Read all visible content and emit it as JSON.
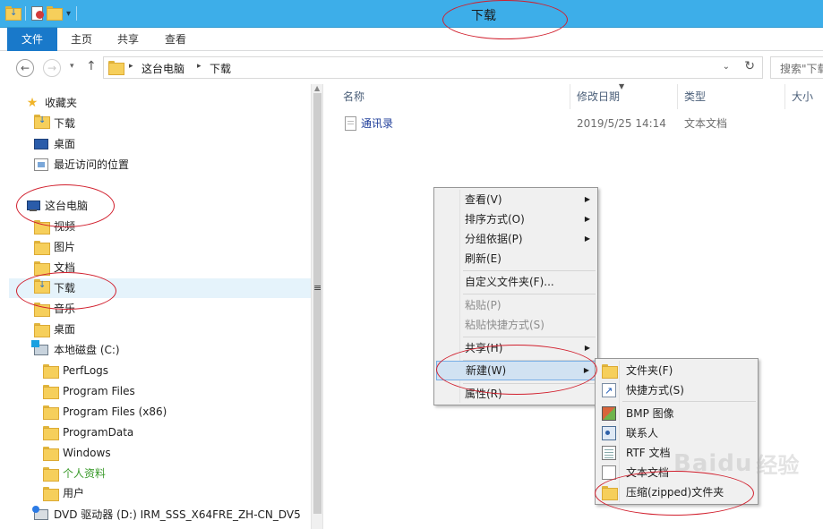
{
  "window": {
    "title": "下载"
  },
  "ribbon": {
    "tabs": [
      "文件",
      "主页",
      "共享",
      "查看"
    ]
  },
  "address": {
    "crumbs": [
      "这台电脑",
      "下载"
    ],
    "search_placeholder": "搜索\"下载\""
  },
  "nav": {
    "favorites": {
      "header": "收藏夹",
      "items": [
        "下载",
        "桌面",
        "最近访问的位置"
      ]
    },
    "this_pc": {
      "header": "这台电脑",
      "items": [
        "视频",
        "图片",
        "文档",
        "下载",
        "音乐",
        "桌面"
      ]
    },
    "local_disk": {
      "header": "本地磁盘 (C:)",
      "items": [
        "PerfLogs",
        "Program Files",
        "Program Files (x86)",
        "ProgramData",
        "Windows",
        "个人资料",
        "用户"
      ]
    },
    "dvd": "DVD 驱动器 (D:) IRM_SSS_X64FRE_ZH-CN_DV5"
  },
  "filelist": {
    "columns": [
      "名称",
      "修改日期",
      "类型",
      "大小"
    ],
    "rows": [
      {
        "name": "通讯录",
        "modified": "2019/5/25 14:14",
        "type": "文本文档"
      }
    ]
  },
  "context_menu": {
    "items": [
      "查看(V)",
      "排序方式(O)",
      "分组依据(P)",
      "刷新(E)",
      "自定义文件夹(F)...",
      "粘贴(P)",
      "粘贴快捷方式(S)",
      "共享(H)",
      "新建(W)",
      "属性(R)"
    ]
  },
  "new_menu": {
    "items": [
      "文件夹(F)",
      "快捷方式(S)",
      "BMP 图像",
      "联系人",
      "RTF 文档",
      "文本文档",
      "压缩(zipped)文件夹"
    ]
  },
  "watermark": {
    "brand": "Baidu",
    "sub": "经验"
  },
  "colors": {
    "titlebar": "#3daee9",
    "file_tab": "#1979ca",
    "annotation": "#d11f2d",
    "highlight": "#d1e2f2"
  }
}
